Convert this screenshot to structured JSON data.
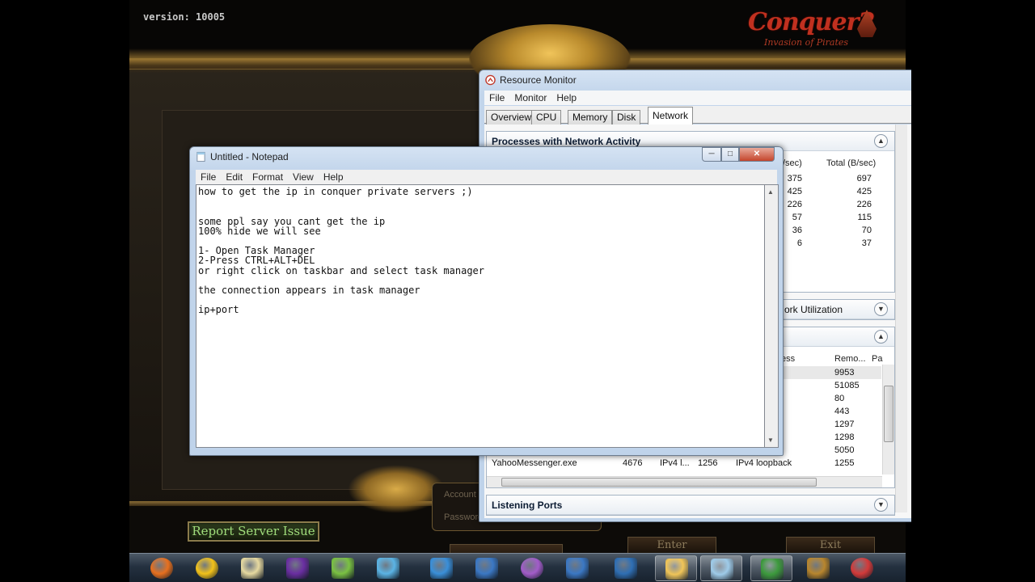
{
  "game": {
    "version": "version: 10005",
    "logo_main": "Conquer2",
    "logo_sub": "Invasion of Pirates",
    "login_account": "Account",
    "login_password": "Password",
    "report_button": "Report Server Issue",
    "enter_button": "Enter",
    "exit_button": "Exit"
  },
  "resmon": {
    "title": "Resource Monitor",
    "menu": [
      "File",
      "Monitor",
      "Help"
    ],
    "tabs": [
      "Overview",
      "CPU",
      "Memory",
      "Disk",
      "Network"
    ],
    "active_tab": "Network",
    "processes_section": {
      "title": "Processes with Network Activity",
      "col_partial": "/sec)",
      "col_total": "Total (B/sec)",
      "rows": [
        {
          "send": "375",
          "total": "697"
        },
        {
          "send": "425",
          "total": "425"
        },
        {
          "send": "226",
          "total": "226"
        },
        {
          "send": "57",
          "total": "115"
        },
        {
          "send": "36",
          "total": "70"
        },
        {
          "send": "6",
          "total": "37"
        }
      ]
    },
    "network_activity_partial": "ork Utilization",
    "tcp_section": {
      "col_address_partial": "ess",
      "col_remote_port": "Remo...",
      "col_packet_partial": "Pa",
      "remote_ports": [
        "9953",
        "51085",
        "80",
        "443",
        "1297",
        "1298",
        "5050",
        "1255"
      ],
      "visible_row": {
        "image": "YahooMessenger.exe",
        "pid": "4676",
        "protocol": "IPv4 l...",
        "local_port": "1256",
        "remote_address": "IPv4 loopback",
        "remote_port": "1255"
      }
    },
    "listening_ports": "Listening Ports"
  },
  "notepad": {
    "title": "Untitled - Notepad",
    "menu": [
      "File",
      "Edit",
      "Format",
      "View",
      "Help"
    ],
    "lines": [
      "how to get the ip in conquer private servers ;)",
      "",
      "",
      "some ppl say you cant get the ip",
      "100% hide we will see",
      "",
      "1- Open Task Manager",
      "2-Press CTRL+ALT+DEL",
      "or right click on taskbar and select task manager",
      "",
      "the connection appears in task manager",
      "",
      "ip+port"
    ]
  },
  "taskbar": {
    "items": [
      {
        "name": "firefox-icon",
        "color": "#e7701f"
      },
      {
        "name": "yahoo-messenger-icon",
        "color": "#f2c21a"
      },
      {
        "name": "screen-tool-icon",
        "color": "#e6d9a0"
      },
      {
        "name": "visual-studio-icon",
        "color": "#6a2ea1"
      },
      {
        "name": "chart-doc-icon",
        "color": "#7ac142"
      },
      {
        "name": "cube-icon",
        "color": "#5bb4e5"
      },
      {
        "name": "monitor-icon",
        "color": "#3a8fd9"
      },
      {
        "name": "swirl-icon",
        "color": "#3b78c4"
      },
      {
        "name": "bonzi-icon",
        "color": "#a25cc9"
      },
      {
        "name": "swirl-icon-2",
        "color": "#3b78c4"
      },
      {
        "name": "virtualbox-icon",
        "color": "#2f6fb4"
      },
      {
        "name": "explorer-folder-icon",
        "color": "#f0c558"
      },
      {
        "name": "notepad-icon",
        "color": "#9ecbe9"
      },
      {
        "name": "resource-monitor-icon",
        "color": "#3c9a3c"
      },
      {
        "name": "conquer-icon",
        "color": "#b8862e"
      },
      {
        "name": "opera-icon",
        "color": "#d33a3a"
      }
    ]
  }
}
